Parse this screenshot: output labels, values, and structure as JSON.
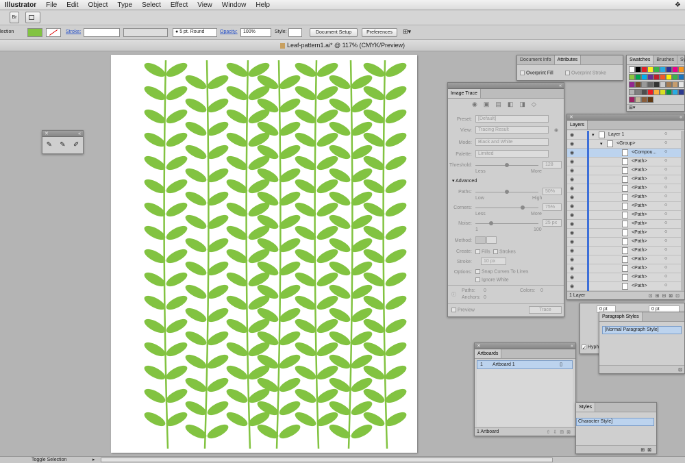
{
  "menubar": {
    "app": "Illustrator",
    "items": [
      "File",
      "Edit",
      "Object",
      "Type",
      "Select",
      "Effect",
      "View",
      "Window",
      "Help"
    ]
  },
  "control": {
    "selection_label": "lection",
    "stroke_label": "Stroke:",
    "brush_value": "5 pt. Round",
    "opacity_label": "Opacity:",
    "opacity_value": "100%",
    "style_label": "Style:",
    "document_setup": "Document Setup",
    "preferences": "Preferences"
  },
  "document": {
    "tab_title": "Leaf-pattern1.ai* @ 117% (CMYK/Preview)"
  },
  "status": {
    "label": "Toggle Selection"
  },
  "doc_info": {
    "tab1": "Document Info",
    "tab2": "Attributes",
    "overprint_fill": "Overprint Fill",
    "overprint_stroke": "Overprint Stroke"
  },
  "swatches": {
    "tab1": "Swatches",
    "tab2": "Brushes",
    "tab3": "Sy"
  },
  "image_trace": {
    "title": "Image Trace",
    "preset_label": "Preset:",
    "preset_value": "[Default]",
    "view_label": "View:",
    "view_value": "Tracing Result",
    "mode_label": "Mode:",
    "mode_value": "Black and White",
    "palette_label": "Palette:",
    "palette_value": "Limited",
    "threshold_label": "Threshold:",
    "threshold_value": "128",
    "threshold_low": "Less",
    "threshold_high": "More",
    "advanced_label": "Advanced",
    "paths_label": "Paths:",
    "paths_value": "50%",
    "paths_low": "Low",
    "paths_high": "High",
    "corners_label": "Corners:",
    "corners_value": "75%",
    "corners_low": "Less",
    "corners_high": "More",
    "noise_label": "Noise:",
    "noise_value": "25 px",
    "noise_low": "1",
    "noise_high": "100",
    "method_label": "Method:",
    "create_label": "Create:",
    "fills": "Fills",
    "strokes": "Strokes",
    "stroke_label": "Stroke:",
    "stroke_value": "10 px",
    "options_label": "Options:",
    "snap": "Snap Curves To Lines",
    "ignore_white": "Ignore White",
    "stat_paths": "Paths:",
    "stat_paths_val": "0",
    "stat_colors": "Colors:",
    "stat_colors_val": "0",
    "stat_anchors": "Anchors:",
    "stat_anchors_val": "0",
    "preview": "Preview",
    "trace": "Trace"
  },
  "layers": {
    "title": "Layers",
    "rows": [
      "Layer 1",
      "<Group>",
      "<Compou...",
      "<Path>",
      "<Path>",
      "<Path>",
      "<Path>",
      "<Path>",
      "<Path>",
      "<Path>",
      "<Path>",
      "<Path>",
      "<Path>",
      "<Path>",
      "<Path>",
      "<Path>",
      "<Path>",
      "<Path>",
      "<Path>"
    ],
    "footer": "1 Layer"
  },
  "paragraph_styles": {
    "title": "Paragraph Styles",
    "item": "[Normal Paragraph Style]"
  },
  "paragraph_snippet": {
    "indent1": "0 pt",
    "indent2": "0 pt",
    "hyph": "Hyph"
  },
  "artboards": {
    "title": "Artboards",
    "num": "1",
    "name": "Artboard 1",
    "footer": "1 Artboard"
  },
  "character_styles": {
    "title": "Styles",
    "item": "Character Style]"
  },
  "colors": {
    "leaf": "#82c341",
    "selected_row": "#bcd3ee"
  }
}
